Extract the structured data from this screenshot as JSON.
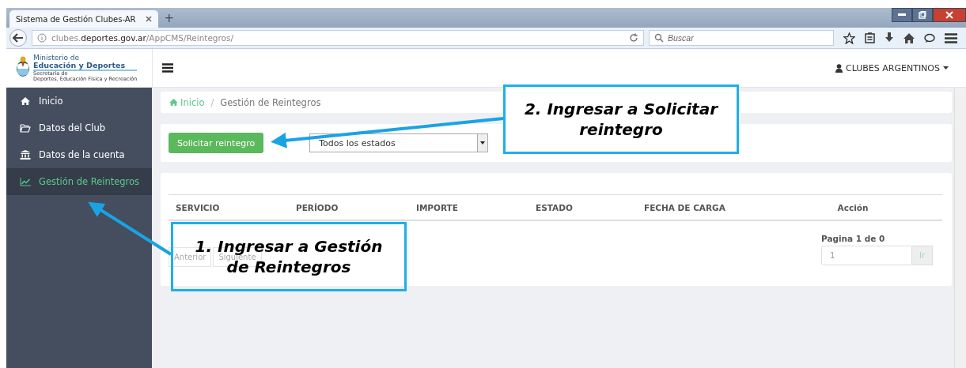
{
  "browser": {
    "tab_title": "Sistema de Gestión Clubes-AR",
    "new_tab": "+",
    "url": "clubes.**deportes.gov.ar**/AppCMS/Reintegros/",
    "search_placeholder": "Buscar"
  },
  "logo": {
    "line1": "Ministerio de",
    "line2": "Educación y Deportes",
    "line3": "Secretaría de",
    "line4": "Deportes, Educación Física y Recreación"
  },
  "user_menu": {
    "label": "CLUBES ARGENTINOS"
  },
  "sidebar": {
    "items": [
      {
        "label": "Inicio",
        "selected": false
      },
      {
        "label": "Datos del Club",
        "selected": false
      },
      {
        "label": "Datos de la cuenta",
        "selected": false
      },
      {
        "label": "Gestión de Reintegros",
        "selected": true
      }
    ]
  },
  "breadcrumb": [
    {
      "label": "Inicio",
      "link": true
    },
    {
      "label": "Gestión de Reintegros",
      "link": false
    }
  ],
  "breadcrumb_separator": "/",
  "toolbar": {
    "button": "Solicitar reintegro",
    "filter": "Todos los estados"
  },
  "table": {
    "columns": [
      "SERVICIO",
      "PERÍODO",
      "IMPORTE",
      "ESTADO",
      "FECHA DE CARGA",
      "Acción"
    ]
  },
  "pagination": {
    "previous": "Anterior",
    "next": "Siguiente",
    "page_label": "Pagina 1 de 0",
    "page_input": "1",
    "go": "Ir"
  },
  "callouts": [
    {
      "text": "1. Ingresar a Gestión de Reintegros"
    },
    {
      "text": "2. Ingresar a Solicitar reintegro"
    }
  ]
}
